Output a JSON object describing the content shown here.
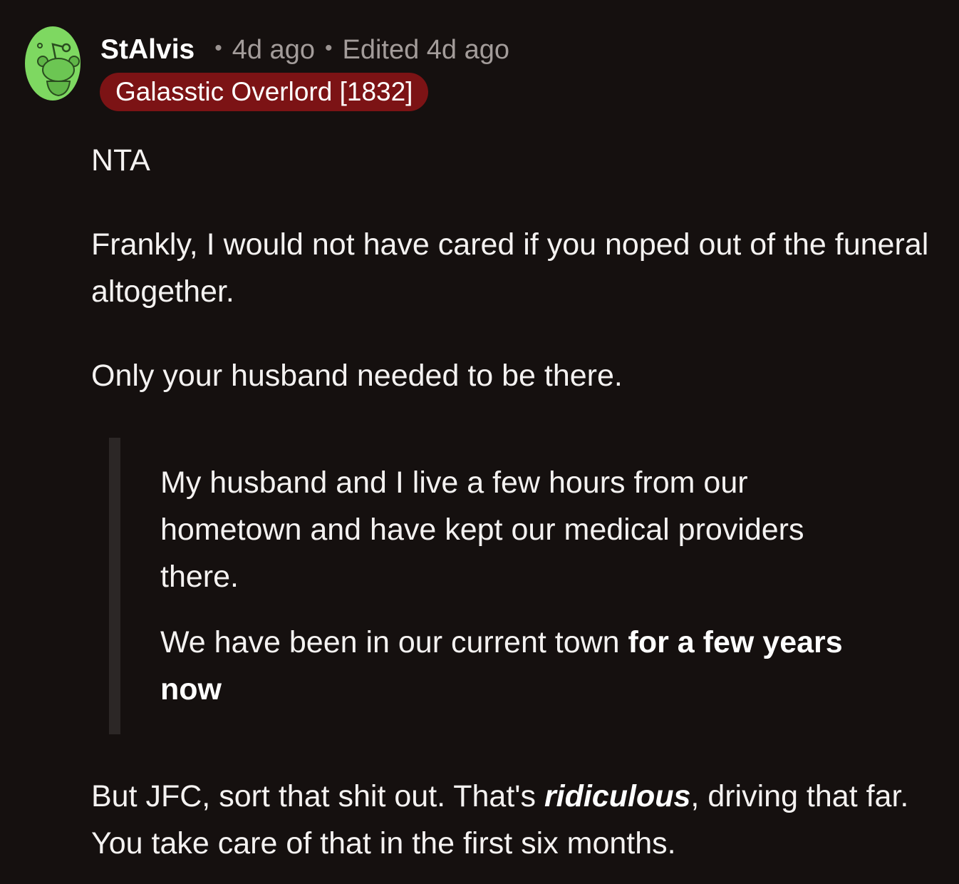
{
  "comment": {
    "username": "StAlvis",
    "separator": "•",
    "timestamp": "4d ago",
    "edited": "Edited 4d ago",
    "flair": "Galasstic Overlord [1832]",
    "avatar_icon": "snoo-avatar-icon",
    "colors": {
      "background": "#15100f",
      "flair_bg": "#7c1315",
      "avatar_green": "#7ed861",
      "quote_bar": "#2c2726"
    },
    "body": {
      "p1": "NTA",
      "p2": "Frankly, I would not have cared if you noped out of the funeral altogether.",
      "p3": "Only your husband needed to be there.",
      "quote": {
        "q1": "My husband and I live a few hours from our hometown and have kept our medical providers there.",
        "q2_plain": "We have been in our current town ",
        "q2_bold": "for a few years now"
      },
      "p4": {
        "a": "But JFC, sort that shit out. That's ",
        "emphasis": "ridiculous",
        "b": ", driving that far. You take care of that in the first six months."
      }
    }
  }
}
